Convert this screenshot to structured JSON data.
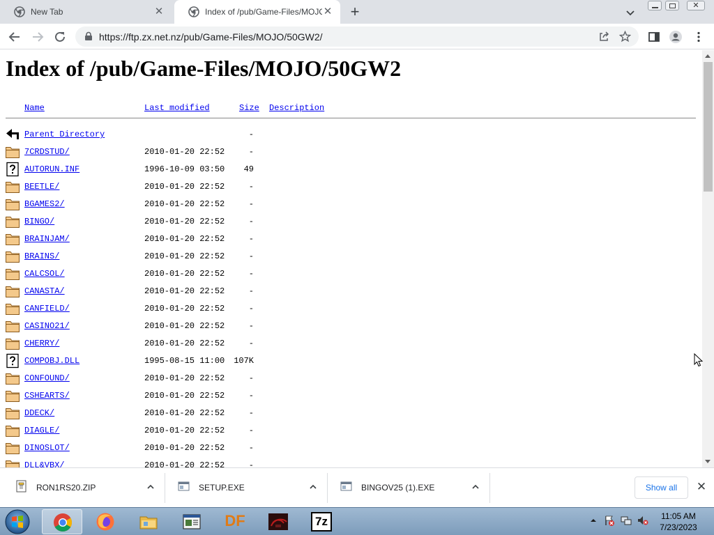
{
  "browser": {
    "tabs": [
      {
        "title": "New Tab",
        "active": false
      },
      {
        "title": "Index of /pub/Game-Files/MOJO/50GW2/",
        "active": true
      }
    ],
    "url": "https://ftp.zx.net.nz/pub/Game-Files/MOJO/50GW2/"
  },
  "page": {
    "title": "Index of /pub/Game-Files/MOJO/50GW2",
    "columns": {
      "name": "Name",
      "last_modified": "Last modified",
      "size": "Size",
      "description": "Description"
    },
    "rows": [
      {
        "icon": "back-arrow-icon",
        "name": "Parent Directory",
        "date": "",
        "size": "-"
      },
      {
        "icon": "folder-icon",
        "name": "7CRDSTUD/",
        "date": "2010-01-20 22:52",
        "size": "-"
      },
      {
        "icon": "unknown-file-icon",
        "name": "AUTORUN.INF",
        "date": "1996-10-09 03:50",
        "size": "49"
      },
      {
        "icon": "folder-icon",
        "name": "BEETLE/",
        "date": "2010-01-20 22:52",
        "size": "-"
      },
      {
        "icon": "folder-icon",
        "name": "BGAMES2/",
        "date": "2010-01-20 22:52",
        "size": "-"
      },
      {
        "icon": "folder-icon",
        "name": "BINGO/",
        "date": "2010-01-20 22:52",
        "size": "-"
      },
      {
        "icon": "folder-icon",
        "name": "BRAINJAM/",
        "date": "2010-01-20 22:52",
        "size": "-"
      },
      {
        "icon": "folder-icon",
        "name": "BRAINS/",
        "date": "2010-01-20 22:52",
        "size": "-"
      },
      {
        "icon": "folder-icon",
        "name": "CALCSOL/",
        "date": "2010-01-20 22:52",
        "size": "-"
      },
      {
        "icon": "folder-icon",
        "name": "CANASTA/",
        "date": "2010-01-20 22:52",
        "size": "-"
      },
      {
        "icon": "folder-icon",
        "name": "CANFIELD/",
        "date": "2010-01-20 22:52",
        "size": "-"
      },
      {
        "icon": "folder-icon",
        "name": "CASINO21/",
        "date": "2010-01-20 22:52",
        "size": "-"
      },
      {
        "icon": "folder-icon",
        "name": "CHERRY/",
        "date": "2010-01-20 22:52",
        "size": "-"
      },
      {
        "icon": "unknown-file-icon",
        "name": "COMPOBJ.DLL",
        "date": "1995-08-15 11:00",
        "size": "107K"
      },
      {
        "icon": "folder-icon",
        "name": "CONFOUND/",
        "date": "2010-01-20 22:52",
        "size": "-"
      },
      {
        "icon": "folder-icon",
        "name": "CSHEARTS/",
        "date": "2010-01-20 22:52",
        "size": "-"
      },
      {
        "icon": "folder-icon",
        "name": "DDECK/",
        "date": "2010-01-20 22:52",
        "size": "-"
      },
      {
        "icon": "folder-icon",
        "name": "DIAGLE/",
        "date": "2010-01-20 22:52",
        "size": "-"
      },
      {
        "icon": "folder-icon",
        "name": "DINOSLOT/",
        "date": "2010-01-20 22:52",
        "size": "-"
      },
      {
        "icon": "folder-icon",
        "name": "DLL&VBX/",
        "date": "2010-01-20 22:52",
        "size": "-"
      }
    ]
  },
  "downloads": {
    "items": [
      {
        "name": "RON1RS20.ZIP",
        "icon": "zip-file-icon"
      },
      {
        "name": "SETUP.EXE",
        "icon": "exe-file-icon"
      },
      {
        "name": "BINGOV25 (1).EXE",
        "icon": "exe-file-icon"
      }
    ],
    "show_all": "Show all"
  },
  "taskbar": {
    "apps": [
      {
        "name": "chrome-taskbar-icon",
        "active": true
      },
      {
        "name": "firefox-taskbar-icon",
        "active": false
      },
      {
        "name": "file-explorer-taskbar-icon",
        "active": false
      },
      {
        "name": "window-app-taskbar-icon",
        "active": false
      },
      {
        "name": "df-taskbar-icon",
        "label": "DF",
        "active": false
      },
      {
        "name": "game-taskbar-icon",
        "active": false
      },
      {
        "name": "7zip-taskbar-icon",
        "label": "7z",
        "active": false
      }
    ],
    "time": "11:05 AM",
    "date": "7/23/2023"
  },
  "colors": {
    "link": "#0000ee",
    "tabstrip": "#dee1e6",
    "taskbar": "#8eaccb",
    "show_all": "#1a73e8"
  }
}
